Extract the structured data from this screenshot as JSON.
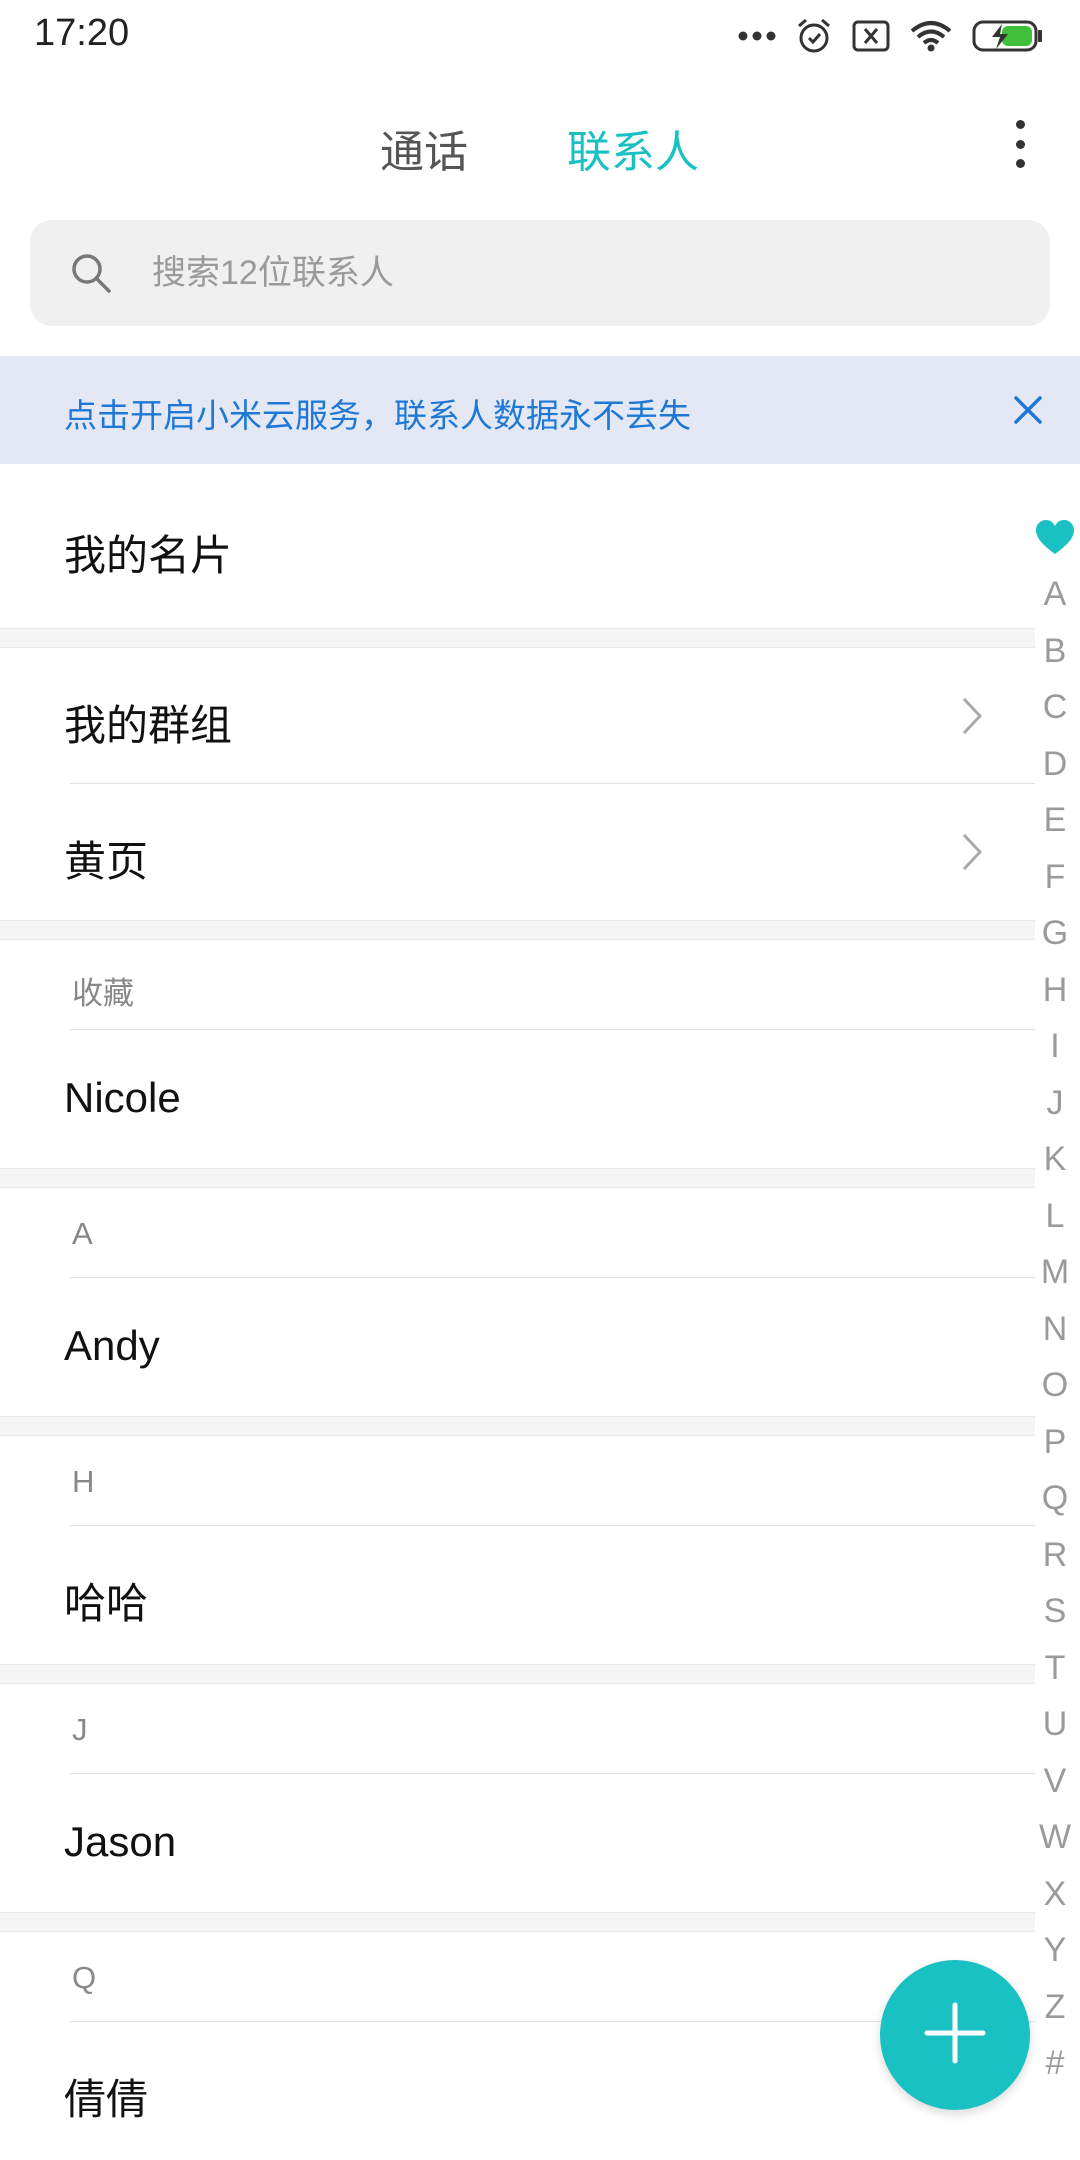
{
  "status_bar": {
    "time": "17:20"
  },
  "header": {
    "tabs": [
      {
        "label": "通话"
      },
      {
        "label": "联系人"
      }
    ],
    "active_color": "#19c1c3"
  },
  "search": {
    "placeholder": "搜索12位联系人"
  },
  "cloud_banner": {
    "text": "点击开启小米云服务，联系人数据永不丢失"
  },
  "list": {
    "my_card": "我的名片",
    "my_groups": "我的群组",
    "yellow_pages": "黄页",
    "sections": [
      {
        "header": "收藏",
        "contacts": [
          "Nicole"
        ]
      },
      {
        "header": "A",
        "contacts": [
          "Andy"
        ]
      },
      {
        "header": "H",
        "contacts": [
          "哈哈"
        ]
      },
      {
        "header": "J",
        "contacts": [
          "Jason"
        ]
      },
      {
        "header": "Q",
        "contacts": [
          "倩倩"
        ]
      }
    ]
  },
  "alpha_index": [
    "A",
    "B",
    "C",
    "D",
    "E",
    "F",
    "G",
    "H",
    "I",
    "J",
    "K",
    "L",
    "M",
    "N",
    "O",
    "P",
    "Q",
    "R",
    "S",
    "T",
    "U",
    "V",
    "W",
    "X",
    "Y",
    "Z",
    "#"
  ],
  "icons": {
    "search": "search-icon",
    "close": "close-icon",
    "chevron": "chevron-right-icon",
    "favorite": "heart-icon",
    "add": "plus-icon",
    "more": "more-vertical-icon"
  }
}
